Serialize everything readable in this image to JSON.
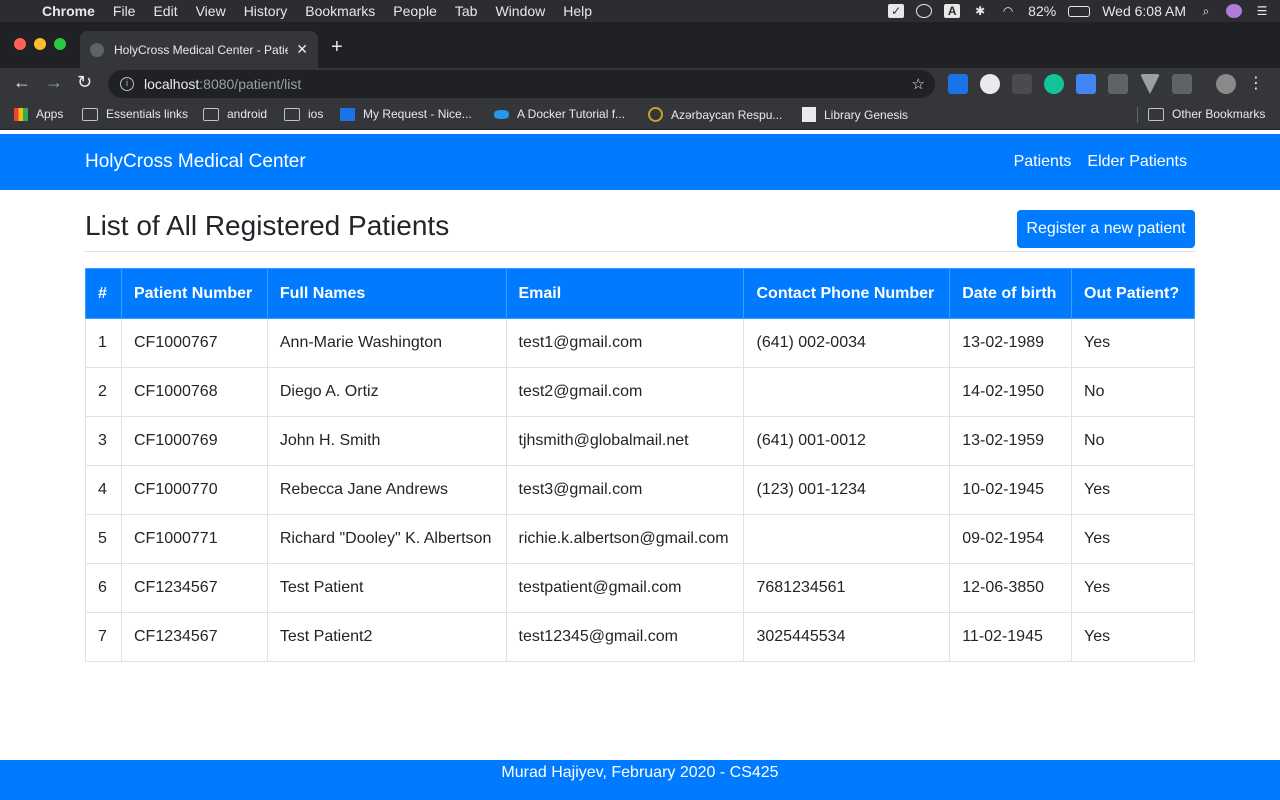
{
  "mac_menu": {
    "app": "Chrome",
    "items": [
      "File",
      "Edit",
      "View",
      "History",
      "Bookmarks",
      "People",
      "Tab",
      "Window",
      "Help"
    ],
    "battery": "82%",
    "clock": "Wed 6:08 AM"
  },
  "browser": {
    "tab_title": "HolyCross Medical Center - Patie",
    "url_host": "localhost",
    "url_rest": ":8080/patient/list",
    "bookmarks": [
      "Apps",
      "Essentials links",
      "android",
      "ios",
      "My Request - Nice...",
      "A Docker Tutorial f...",
      "Azərbaycan Respu...",
      "Library Genesis",
      "Other Bookmarks"
    ]
  },
  "navbar": {
    "brand": "HolyCross Medical Center",
    "links": [
      "Patients",
      "Elder Patients"
    ]
  },
  "main": {
    "title": "List of All Registered Patients",
    "register_button": "Register a new patient"
  },
  "table": {
    "headers": [
      "#",
      "Patient Number",
      "Full Names",
      "Email",
      "Contact Phone Number",
      "Date of birth",
      "Out Patient?"
    ],
    "rows": [
      [
        "1",
        "CF1000767",
        "Ann-Marie Washington",
        "test1@gmail.com",
        "(641) 002-0034",
        "13-02-1989",
        "Yes"
      ],
      [
        "2",
        "CF1000768",
        "Diego A. Ortiz",
        "test2@gmail.com",
        "",
        "14-02-1950",
        "No"
      ],
      [
        "3",
        "CF1000769",
        "John H. Smith",
        "tjhsmith@globalmail.net",
        "(641) 001-0012",
        "13-02-1959",
        "No"
      ],
      [
        "4",
        "CF1000770",
        "Rebecca Jane Andrews",
        "test3@gmail.com",
        "(123) 001-1234",
        "10-02-1945",
        "Yes"
      ],
      [
        "5",
        "CF1000771",
        "Richard \"Dooley\" K. Albertson",
        "richie.k.albertson@gmail.com",
        "",
        "09-02-1954",
        "Yes"
      ],
      [
        "6",
        "CF1234567",
        "Test Patient",
        "testpatient@gmail.com",
        "7681234561",
        "12-06-3850",
        "Yes"
      ],
      [
        "7",
        "CF1234567",
        "Test Patient2",
        "test12345@gmail.com",
        "3025445534",
        "11-02-1945",
        "Yes"
      ]
    ]
  },
  "footer": {
    "text": "Murad Hajiyev, February 2020 - CS425"
  },
  "colors": {
    "primary": "#007bff"
  }
}
